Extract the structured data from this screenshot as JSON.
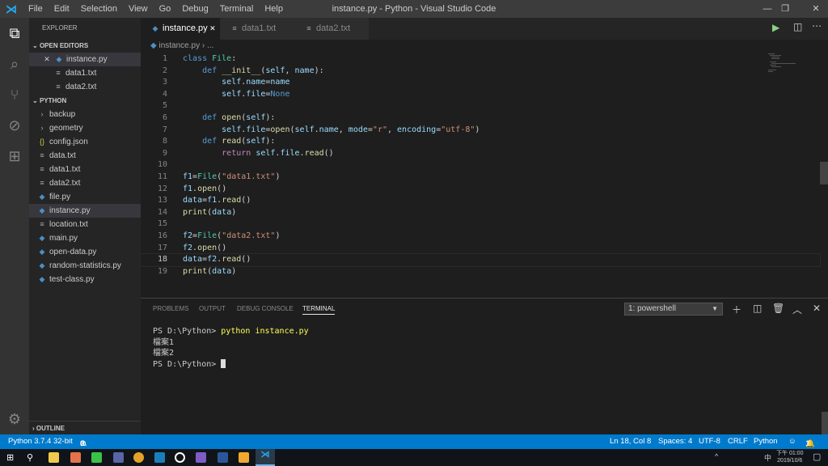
{
  "window": {
    "title": "instance.py - Python - Visual Studio Code",
    "menu": [
      "File",
      "Edit",
      "Selection",
      "View",
      "Go",
      "Debug",
      "Terminal",
      "Help"
    ]
  },
  "sidebar": {
    "header": "EXPLORER",
    "open_editors": {
      "label": "OPEN EDITORS",
      "items": [
        {
          "name": "instance.py",
          "type": "py"
        },
        {
          "name": "data1.txt",
          "type": "txt"
        },
        {
          "name": "data2.txt",
          "type": "txt"
        }
      ]
    },
    "folder": {
      "label": "PYTHON",
      "items": [
        {
          "name": "backup",
          "type": "folder"
        },
        {
          "name": "geometry",
          "type": "folder"
        },
        {
          "name": "config.json",
          "type": "json"
        },
        {
          "name": "data.txt",
          "type": "txt"
        },
        {
          "name": "data1.txt",
          "type": "txt"
        },
        {
          "name": "data2.txt",
          "type": "txt"
        },
        {
          "name": "file.py",
          "type": "py"
        },
        {
          "name": "instance.py",
          "type": "py",
          "selected": true
        },
        {
          "name": "location.txt",
          "type": "txt"
        },
        {
          "name": "main.py",
          "type": "py"
        },
        {
          "name": "open-data.py",
          "type": "py"
        },
        {
          "name": "random-statistics.py",
          "type": "py"
        },
        {
          "name": "test-class.py",
          "type": "py"
        }
      ]
    },
    "outline": "OUTLINE"
  },
  "tabs": [
    {
      "label": "instance.py",
      "type": "py",
      "active": true
    },
    {
      "label": "data1.txt",
      "type": "txt"
    },
    {
      "label": "data2.txt",
      "type": "txt"
    }
  ],
  "breadcrumb": [
    "instance.py",
    "..."
  ],
  "editor": {
    "current_line": 18,
    "lines": [
      [
        [
          "class ",
          "kw"
        ],
        [
          "File",
          "cls"
        ],
        [
          ":",
          "p"
        ]
      ],
      [
        [
          "    def ",
          "kw"
        ],
        [
          "__init__",
          "fn"
        ],
        [
          "(",
          "p"
        ],
        [
          "self",
          "var"
        ],
        [
          ", ",
          "p"
        ],
        [
          "name",
          "var"
        ],
        [
          "):",
          "p"
        ]
      ],
      [
        [
          "        self",
          "var"
        ],
        [
          ".",
          "p"
        ],
        [
          "name",
          "var"
        ],
        [
          "=",
          "p"
        ],
        [
          "name",
          "var"
        ]
      ],
      [
        [
          "        self",
          "var"
        ],
        [
          ".",
          "p"
        ],
        [
          "file",
          "var"
        ],
        [
          "=",
          "p"
        ],
        [
          "None",
          "kw"
        ]
      ],
      [],
      [
        [
          "    def ",
          "kw"
        ],
        [
          "open",
          "fn"
        ],
        [
          "(",
          "p"
        ],
        [
          "self",
          "var"
        ],
        [
          "):",
          "p"
        ]
      ],
      [
        [
          "        self",
          "var"
        ],
        [
          ".",
          "p"
        ],
        [
          "file",
          "var"
        ],
        [
          "=",
          "p"
        ],
        [
          "open",
          "fn"
        ],
        [
          "(",
          "p"
        ],
        [
          "self",
          "var"
        ],
        [
          ".",
          "p"
        ],
        [
          "name",
          "var"
        ],
        [
          ", ",
          "p"
        ],
        [
          "mode",
          "var"
        ],
        [
          "=",
          "p"
        ],
        [
          "\"r\"",
          "str"
        ],
        [
          ", ",
          "p"
        ],
        [
          "encoding",
          "var"
        ],
        [
          "=",
          "p"
        ],
        [
          "\"utf-8\"",
          "str"
        ],
        [
          ")",
          "p"
        ]
      ],
      [
        [
          "    def ",
          "kw"
        ],
        [
          "read",
          "fn"
        ],
        [
          "(",
          "p"
        ],
        [
          "self",
          "var"
        ],
        [
          "):",
          "p"
        ]
      ],
      [
        [
          "        return ",
          "ctl"
        ],
        [
          "self",
          "var"
        ],
        [
          ".",
          "p"
        ],
        [
          "file",
          "var"
        ],
        [
          ".",
          "p"
        ],
        [
          "read",
          "fn"
        ],
        [
          "()",
          "p"
        ]
      ],
      [],
      [
        [
          "f1",
          "var"
        ],
        [
          "=",
          "p"
        ],
        [
          "File",
          "cls"
        ],
        [
          "(",
          "p"
        ],
        [
          "\"data1.txt\"",
          "str"
        ],
        [
          ")",
          "p"
        ]
      ],
      [
        [
          "f1",
          "var"
        ],
        [
          ".",
          "p"
        ],
        [
          "open",
          "fn"
        ],
        [
          "()",
          "p"
        ]
      ],
      [
        [
          "data",
          "var"
        ],
        [
          "=",
          "p"
        ],
        [
          "f1",
          "var"
        ],
        [
          ".",
          "p"
        ],
        [
          "read",
          "fn"
        ],
        [
          "()",
          "p"
        ]
      ],
      [
        [
          "print",
          "fn"
        ],
        [
          "(",
          "p"
        ],
        [
          "data",
          "var"
        ],
        [
          ")",
          "p"
        ]
      ],
      [],
      [
        [
          "f2",
          "var"
        ],
        [
          "=",
          "p"
        ],
        [
          "File",
          "cls"
        ],
        [
          "(",
          "p"
        ],
        [
          "\"data2.txt\"",
          "str"
        ],
        [
          ")",
          "p"
        ]
      ],
      [
        [
          "f2",
          "var"
        ],
        [
          ".",
          "p"
        ],
        [
          "open",
          "fn"
        ],
        [
          "()",
          "p"
        ]
      ],
      [
        [
          "data",
          "var"
        ],
        [
          "=",
          "p"
        ],
        [
          "f2",
          "var"
        ],
        [
          ".",
          "p"
        ],
        [
          "read",
          "fn"
        ],
        [
          "()",
          "p"
        ]
      ],
      [
        [
          "print",
          "fn"
        ],
        [
          "(",
          "p"
        ],
        [
          "data",
          "var"
        ],
        [
          ")",
          "p"
        ]
      ]
    ]
  },
  "panel": {
    "tabs": [
      "PROBLEMS",
      "OUTPUT",
      "DEBUG CONSOLE",
      "TERMINAL"
    ],
    "active_tab": "TERMINAL",
    "terminal_select": "1: powershell",
    "terminal": {
      "prompt1": "PS D:\\Python> ",
      "command": "python instance.py",
      "output": [
        "檔案1",
        "檔案2"
      ],
      "prompt2": "PS D:\\Python> "
    }
  },
  "status": {
    "interpreter": "Python 3.7.4 32-bit",
    "errors": "0",
    "warnings": "0",
    "position": "Ln 18, Col 8",
    "spaces": "Spaces: 4",
    "encoding": "UTF-8",
    "eol": "CRLF",
    "language": "Python",
    "notifications": "1"
  },
  "taskbar": {
    "time": "下午 01:00",
    "date": "2019/10/6",
    "ime": "中"
  },
  "colors": {
    "status_bar": "#007acc",
    "activity_bar": "#333333",
    "sidebar": "#252526",
    "editor": "#1e1e1e"
  }
}
